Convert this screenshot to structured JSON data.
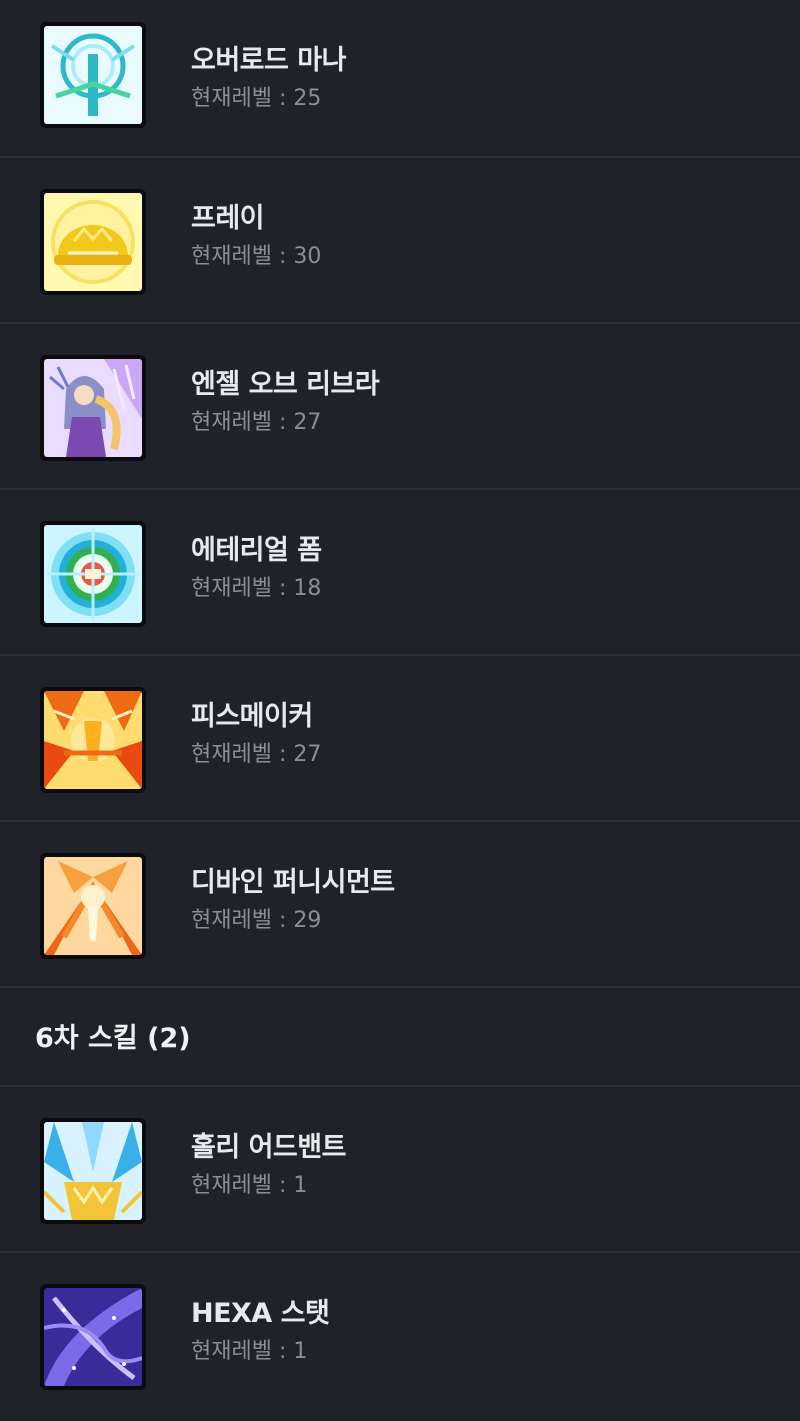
{
  "level_prefix": "현재레벨 : ",
  "groups": [
    {
      "skills": [
        {
          "name": "오버로드 마나",
          "level": "25",
          "icon": "overload-mana-icon",
          "palette": [
            "#e9fbff",
            "#2fb8c8",
            "#a8eef7"
          ]
        },
        {
          "name": "프레이",
          "level": "30",
          "icon": "pray-icon",
          "palette": [
            "#fff8b0",
            "#f2c81a",
            "#fff2a0"
          ]
        },
        {
          "name": "엔젤 오브 리브라",
          "level": "27",
          "icon": "angel-of-libra-icon",
          "palette": [
            "#e9dcff",
            "#8a5ad0",
            "#f3c46a"
          ]
        },
        {
          "name": "에테리얼 폼",
          "level": "18",
          "icon": "ethereal-form-icon",
          "palette": [
            "#ccf5ff",
            "#22b0d8",
            "#32b050"
          ]
        },
        {
          "name": "피스메이커",
          "level": "27",
          "icon": "peacemaker-icon",
          "palette": [
            "#ffdc70",
            "#ef6a14",
            "#ffe89a"
          ]
        },
        {
          "name": "디바인 퍼니시먼트",
          "level": "29",
          "icon": "divine-punishment-icon",
          "palette": [
            "#ffd8a0",
            "#ee6618",
            "#fff1cc"
          ]
        }
      ]
    },
    {
      "header": "6차 스킬 (2)",
      "skills": [
        {
          "name": "홀리 어드밴트",
          "level": "1",
          "icon": "holy-advent-icon",
          "palette": [
            "#d8f3ff",
            "#3ab0e8",
            "#f2c43a"
          ]
        },
        {
          "name": "HEXA 스탯",
          "level": "1",
          "icon": "hexa-stat-icon",
          "palette": [
            "#3a2a9a",
            "#7c6ae8",
            "#c8c4ff"
          ]
        }
      ]
    }
  ]
}
